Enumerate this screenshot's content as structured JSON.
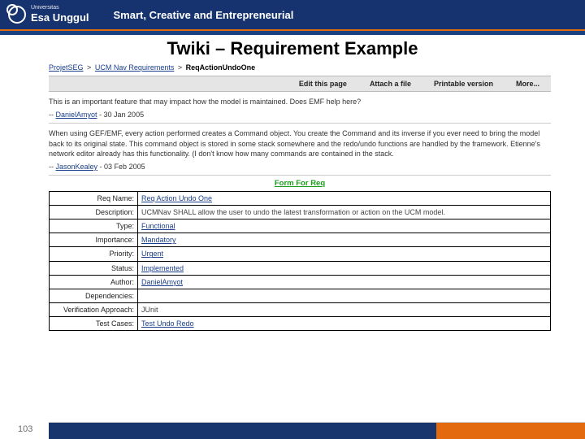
{
  "header": {
    "brand_top": "Universitas",
    "brand_name": "Esa Unggul",
    "tagline": "Smart, Creative and Entrepreneurial"
  },
  "slide_title": "Twiki – Requirement Example",
  "breadcrumb": {
    "a": "ProjetSEG",
    "b": "UCM Nav Requirements",
    "current": "ReqActionUndoOne"
  },
  "tabs": {
    "edit": "Edit this page",
    "attach": "Attach a file",
    "print": "Printable version",
    "more": "More..."
  },
  "paragraph1": "This is an important feature that may impact how the model is maintained. Does EMF help here?",
  "sig1_name": "DanielAmyot",
  "sig1_date": "30 Jan 2005",
  "paragraph2": "When using GEF/EMF, every action performed creates a Command object. You create the Command and its inverse if you ever need to bring the model back to its original state. This command object is stored in some stack somewhere and the redo/undo functions are handled by the framework. Etienne's network editor already has this functionality. (I don't know how many commands are contained in the stack.",
  "sig2_name": "JasonKealey",
  "sig2_date": "03 Feb 2005",
  "form_title": "Form For Req",
  "rows": {
    "req_name_l": "Req Name:",
    "req_name_v": "Req Action Undo One",
    "desc_l": "Description:",
    "desc_v": "UCMNav SHALL allow the user to undo the latest transformation or action on the UCM model.",
    "type_l": "Type:",
    "type_v": "Functional",
    "importance_l": "Importance:",
    "importance_v": "Mandatory",
    "priority_l": "Priority:",
    "priority_v": "Urgent",
    "status_l": "Status:",
    "status_v": "Implemented",
    "author_l": "Author:",
    "author_v": "DanielAmyot",
    "deps_l": "Dependencies:",
    "deps_v": "",
    "verif_l": "Verification Approach:",
    "verif_v": "JUnit",
    "tests_l": "Test Cases:",
    "tests_v": "Test Undo Redo"
  },
  "page_number": "103"
}
